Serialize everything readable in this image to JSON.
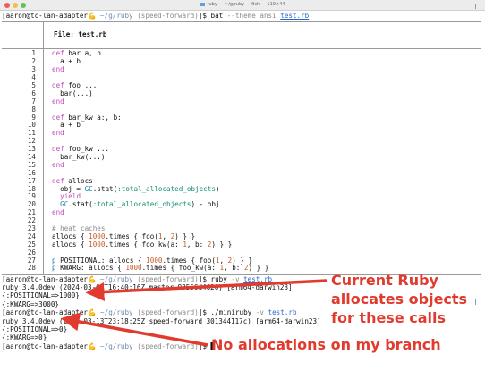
{
  "window": {
    "title": "ruby — ~/g/ruby — fish — 119×44"
  },
  "prompt": {
    "user": "[aaron@tc-lan-adapter",
    "emoji": "💪",
    "path": " ~/g/ruby",
    "branch": " (speed-forward)",
    "end": "]$ "
  },
  "command1": {
    "cmd": "bat",
    "opt": " --theme ansi ",
    "arg": "test.rb"
  },
  "bat": {
    "file_label": "File: test.rb",
    "lines": [
      {
        "n": "1",
        "code": "def bar a, b"
      },
      {
        "n": "2",
        "code": "  a + b"
      },
      {
        "n": "3",
        "code": "end"
      },
      {
        "n": "4",
        "code": ""
      },
      {
        "n": "5",
        "code": "def foo ..."
      },
      {
        "n": "6",
        "code": "  bar(...)"
      },
      {
        "n": "7",
        "code": "end"
      },
      {
        "n": "8",
        "code": ""
      },
      {
        "n": "9",
        "code": "def bar_kw a:, b:"
      },
      {
        "n": "10",
        "code": "  a + b"
      },
      {
        "n": "11",
        "code": "end"
      },
      {
        "n": "12",
        "code": ""
      },
      {
        "n": "13",
        "code": "def foo_kw ..."
      },
      {
        "n": "14",
        "code": "  bar_kw(...)"
      },
      {
        "n": "15",
        "code": "end"
      },
      {
        "n": "16",
        "code": ""
      },
      {
        "n": "17",
        "code": "def allocs"
      },
      {
        "n": "18",
        "code": "  obj = GC.stat(:total_allocated_objects)"
      },
      {
        "n": "19",
        "code": "  yield"
      },
      {
        "n": "20",
        "code": "  GC.stat(:total_allocated_objects) - obj"
      },
      {
        "n": "21",
        "code": "end"
      },
      {
        "n": "22",
        "code": ""
      },
      {
        "n": "23",
        "code": "# heat caches"
      },
      {
        "n": "24",
        "code": "allocs { 1000.times { foo(1, 2) } }"
      },
      {
        "n": "25",
        "code": "allocs { 1000.times { foo_kw(a: 1, b: 2) } }"
      },
      {
        "n": "26",
        "code": ""
      },
      {
        "n": "27",
        "code": "p POSITIONAL: allocs { 1000.times { foo(1, 2) } }"
      },
      {
        "n": "28",
        "code": "p KWARG: allocs { 1000.times { foo_kw(a: 1, b: 2) } }"
      }
    ]
  },
  "command2": {
    "cmd": "ruby",
    "opt": " -v ",
    "arg": "test.rb"
  },
  "output2": [
    "ruby 3.4.0dev (2024-03-02T16:40:16Z master 93556d4620) [arm64-darwin23]",
    "{:POSITIONAL=>1000}",
    "{:KWARG=>3000}"
  ],
  "command3": {
    "cmd": "./miniruby",
    "opt": " -v ",
    "arg": "test.rb"
  },
  "output3": [
    "ruby 3.4.0dev (2024-03-13T23:18:25Z speed-forward 301344117c) [arm64-darwin23]",
    "{:POSITIONAL=>0}",
    "{:KWARG=>0}"
  ],
  "annotations": {
    "current_ruby": "Current Ruby allocates objects for these calls",
    "no_alloc": "No allocations on my branch"
  },
  "colors": {
    "annotation": "#e03b2e",
    "keyword": "#c24bb5",
    "symbol": "#148f74",
    "number": "#c45a2a"
  }
}
